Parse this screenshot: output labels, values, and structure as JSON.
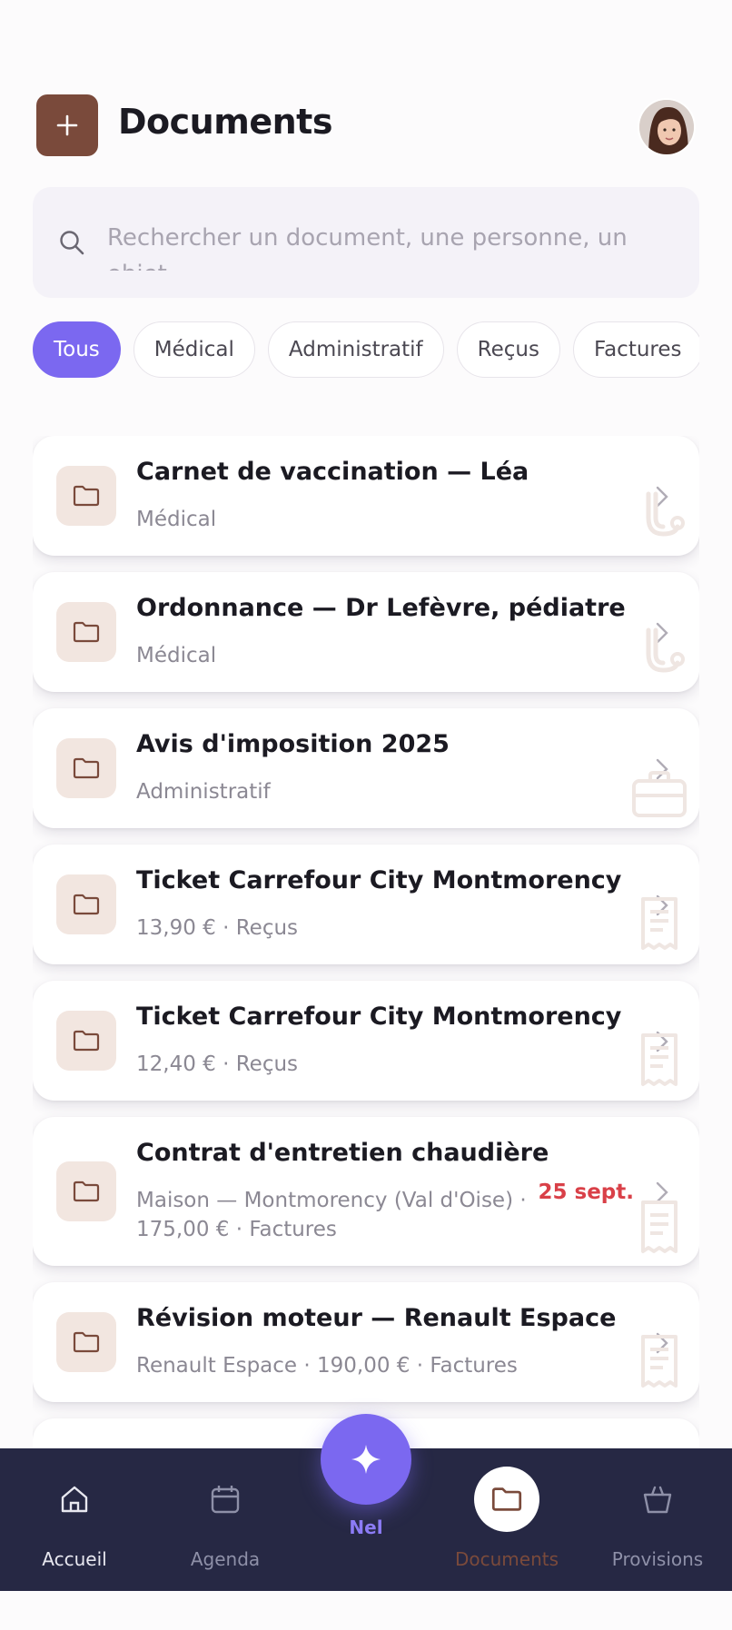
{
  "header": {
    "title": "Documents",
    "add_icon": "plus-icon",
    "avatar": "user-avatar"
  },
  "search": {
    "placeholder": "Rechercher un document, une personne, un objet…",
    "icon": "search-icon"
  },
  "filters": [
    {
      "label": "Tous",
      "active": true
    },
    {
      "label": "Médical",
      "active": false
    },
    {
      "label": "Administratif",
      "active": false
    },
    {
      "label": "Reçus",
      "active": false
    },
    {
      "label": "Factures",
      "active": false
    }
  ],
  "documents": [
    {
      "title": "Carnet de vaccination — Léa",
      "subtitle": "Médical",
      "watermark": "stethoscope-icon"
    },
    {
      "title": "Ordonnance — Dr Lefèvre, pédiatre",
      "subtitle": "Médical",
      "watermark": "stethoscope-icon"
    },
    {
      "title": "Avis d'imposition 2025",
      "subtitle": "Administratif",
      "watermark": "briefcase-icon"
    },
    {
      "title": "Ticket Carrefour City Montmorency",
      "subtitle": "13,90 € · Reçus",
      "watermark": "receipt-icon"
    },
    {
      "title": "Ticket Carrefour City Montmorency",
      "subtitle": "12,40 € · Reçus",
      "watermark": "receipt-icon"
    },
    {
      "title": "Contrat d'entretien chaudière",
      "subtitle_line1": "Maison — Montmorency (Val d'Oise) ·",
      "subtitle_line2": "175,00 € · Factures",
      "date": "25 sept.",
      "watermark": "receipt-icon"
    },
    {
      "title": "Révision moteur — Renault Espace",
      "subtitle": "Renault Espace · 190,00 € · Factures",
      "watermark": "receipt-icon"
    }
  ],
  "nav": {
    "home": "Accueil",
    "agenda": "Agenda",
    "nel": "Nel",
    "documents": "Documents",
    "provisions": "Provisions"
  },
  "colors": {
    "accent": "#7b68f0",
    "brand_brown": "#7a4a3b",
    "nav_bg": "#262844",
    "date_red": "#d94048"
  }
}
